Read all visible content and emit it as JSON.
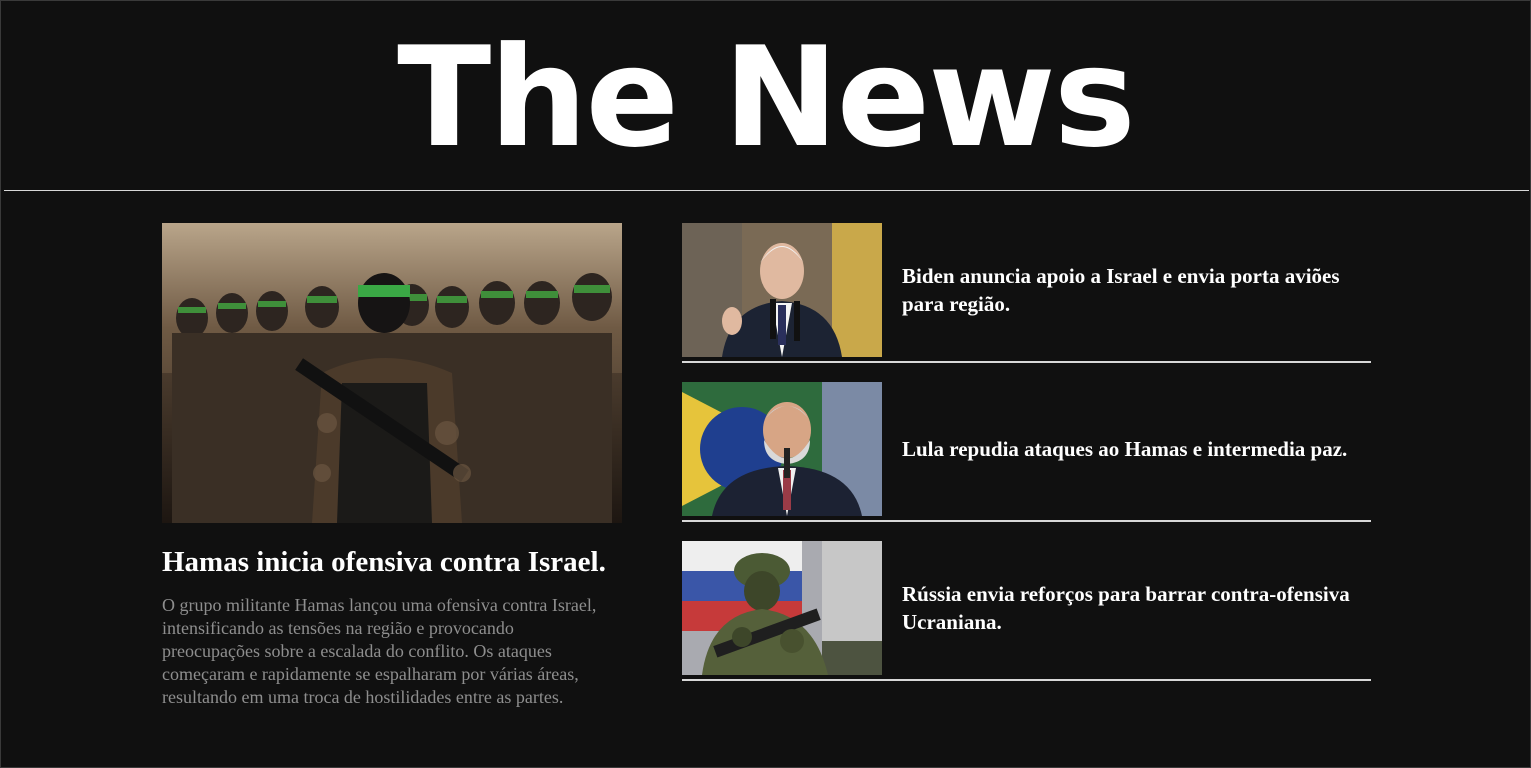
{
  "site": {
    "title": "The News"
  },
  "featured": {
    "image_alt": "Militantes do Hamas em marcha",
    "headline": "Hamas inicia ofensiva contra Israel.",
    "summary": "O grupo militante Hamas lançou uma ofensiva contra Israel, intensificando as tensões na região e provocando preocupações sobre a escalada do conflito. Os ataques começaram e rapidamente se espalharam por várias áreas, resultando em uma troca de hostilidades entre as partes."
  },
  "side_stories": [
    {
      "image_alt": "Biden discursando",
      "headline": "Biden anuncia apoio a Israel e envia porta aviões para região."
    },
    {
      "image_alt": "Lula discursando",
      "headline": "Lula repudia ataques ao Hamas e intermedia paz."
    },
    {
      "image_alt": "Soldado russo",
      "headline": "Rússia envia reforços para barrar contra-ofensiva Ucraniana."
    }
  ],
  "colors": {
    "background": "#101010",
    "text": "#ffffff",
    "summary_text": "#8e8e8e",
    "rule": "#d8d8d8"
  }
}
